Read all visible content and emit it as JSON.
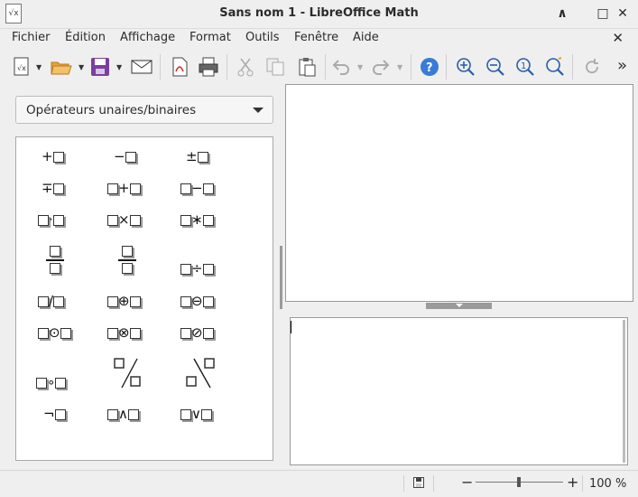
{
  "window": {
    "app_icon_glyph": "√x",
    "title": "Sans nom 1 - LibreOffice Math",
    "btn_minimize": "∧",
    "btn_maximize": "□",
    "btn_close": "✕"
  },
  "menu": {
    "fichier": "Fichier",
    "edition": "Édition",
    "affichage": "Affichage",
    "format": "Format",
    "outils": "Outils",
    "fenetre": "Fenêtre",
    "aide": "Aide",
    "close_doc": "✕"
  },
  "toolbar": {
    "overflow": "»",
    "help": "?",
    "zoom_100": "1"
  },
  "elements": {
    "category": "Opérateurs unaires/binaires",
    "items": {
      "plus": "+",
      "minus": "−",
      "plusminus": "±",
      "minusplus": "∓",
      "add": "+",
      "sub": "−",
      "cdot": "·",
      "times": "×",
      "ast": "∗",
      "div": "÷",
      "slash": "/",
      "oplus": "⊕",
      "ominus": "⊖",
      "odot": "⊙",
      "otimes": "⊗",
      "oslash": "⊘",
      "circ": "∘",
      "neg": "¬",
      "and": "∧",
      "or": "∨"
    }
  },
  "editor": {
    "content": ""
  },
  "status": {
    "save_icon": "save-document-icon",
    "zoom_out": "−",
    "zoom_in": "+",
    "zoom_level": 100,
    "zoom_text": "100 %"
  },
  "colors": {
    "accent_blue": "#3a7bd5",
    "save_purple": "#7b3fa0",
    "folder_orange": "#e8a23a"
  }
}
